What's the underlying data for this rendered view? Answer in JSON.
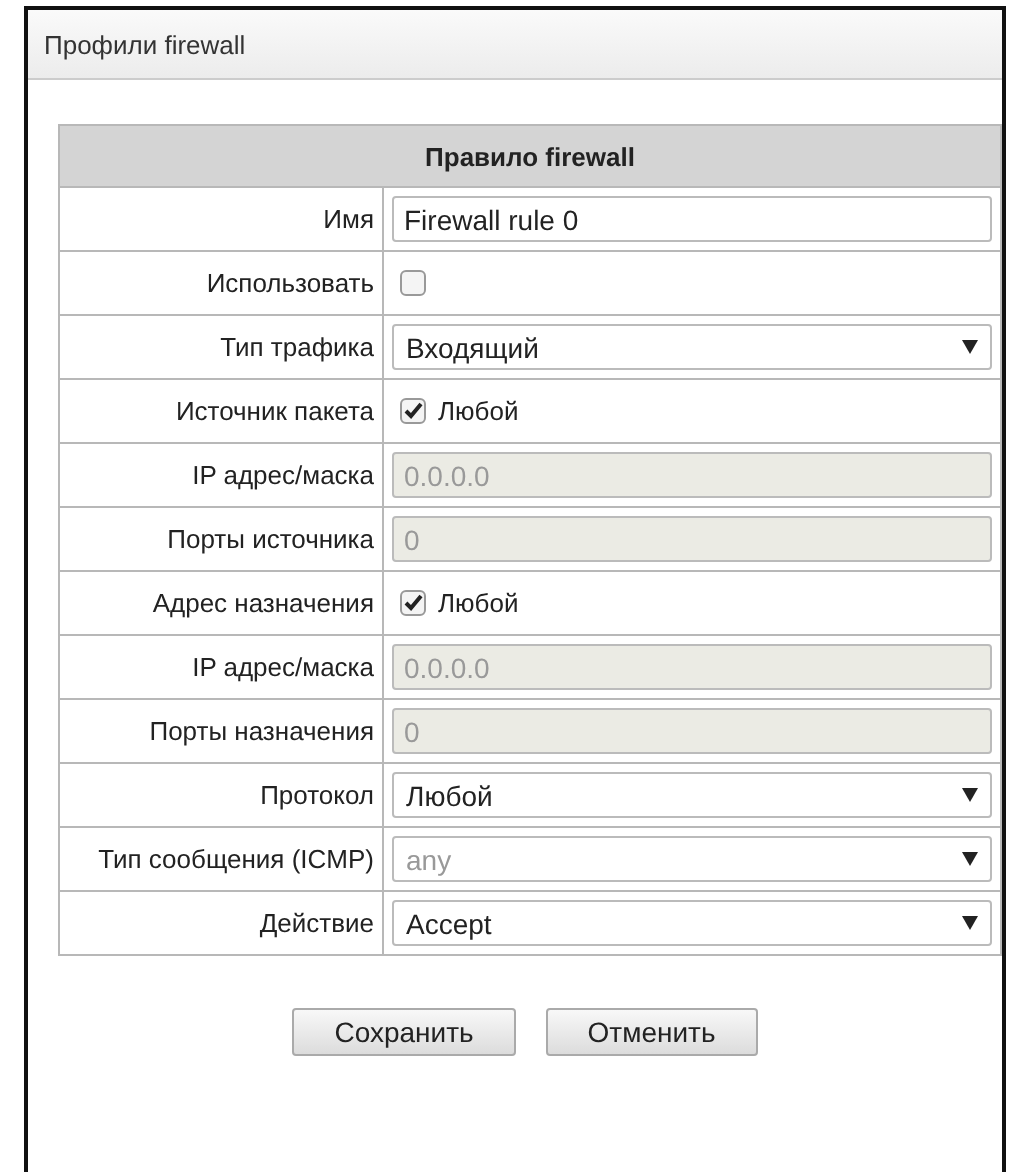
{
  "panel": {
    "title": "Профили firewall"
  },
  "table": {
    "title": "Правило firewall",
    "rows": [
      {
        "label": "Имя",
        "kind": "text",
        "value": "Firewall rule 0",
        "disabled": false
      },
      {
        "label": "Использовать",
        "kind": "checkbox",
        "checked": false
      },
      {
        "label": "Тип трафика",
        "kind": "select",
        "value": "Входящий",
        "disabled": false
      },
      {
        "label": "Источник пакета",
        "kind": "checkbox",
        "checked": true,
        "text": "Любой"
      },
      {
        "label": "IP адрес/маска",
        "kind": "text",
        "value": "0.0.0.0",
        "disabled": true
      },
      {
        "label": "Порты источника",
        "kind": "text",
        "value": "0",
        "disabled": true
      },
      {
        "label": "Адрес назначения",
        "kind": "checkbox",
        "checked": true,
        "text": "Любой"
      },
      {
        "label": "IP адрес/маска",
        "kind": "text",
        "value": "0.0.0.0",
        "disabled": true
      },
      {
        "label": "Порты назначения",
        "kind": "text",
        "value": "0",
        "disabled": true
      },
      {
        "label": "Протокол",
        "kind": "select",
        "value": "Любой",
        "disabled": false
      },
      {
        "label": "Тип сообщения (ICMP)",
        "kind": "select",
        "value": "any",
        "disabled": true
      },
      {
        "label": "Действие",
        "kind": "select",
        "value": "Accept",
        "disabled": false
      }
    ]
  },
  "buttons": [
    "Сохранить",
    "Отменить"
  ]
}
